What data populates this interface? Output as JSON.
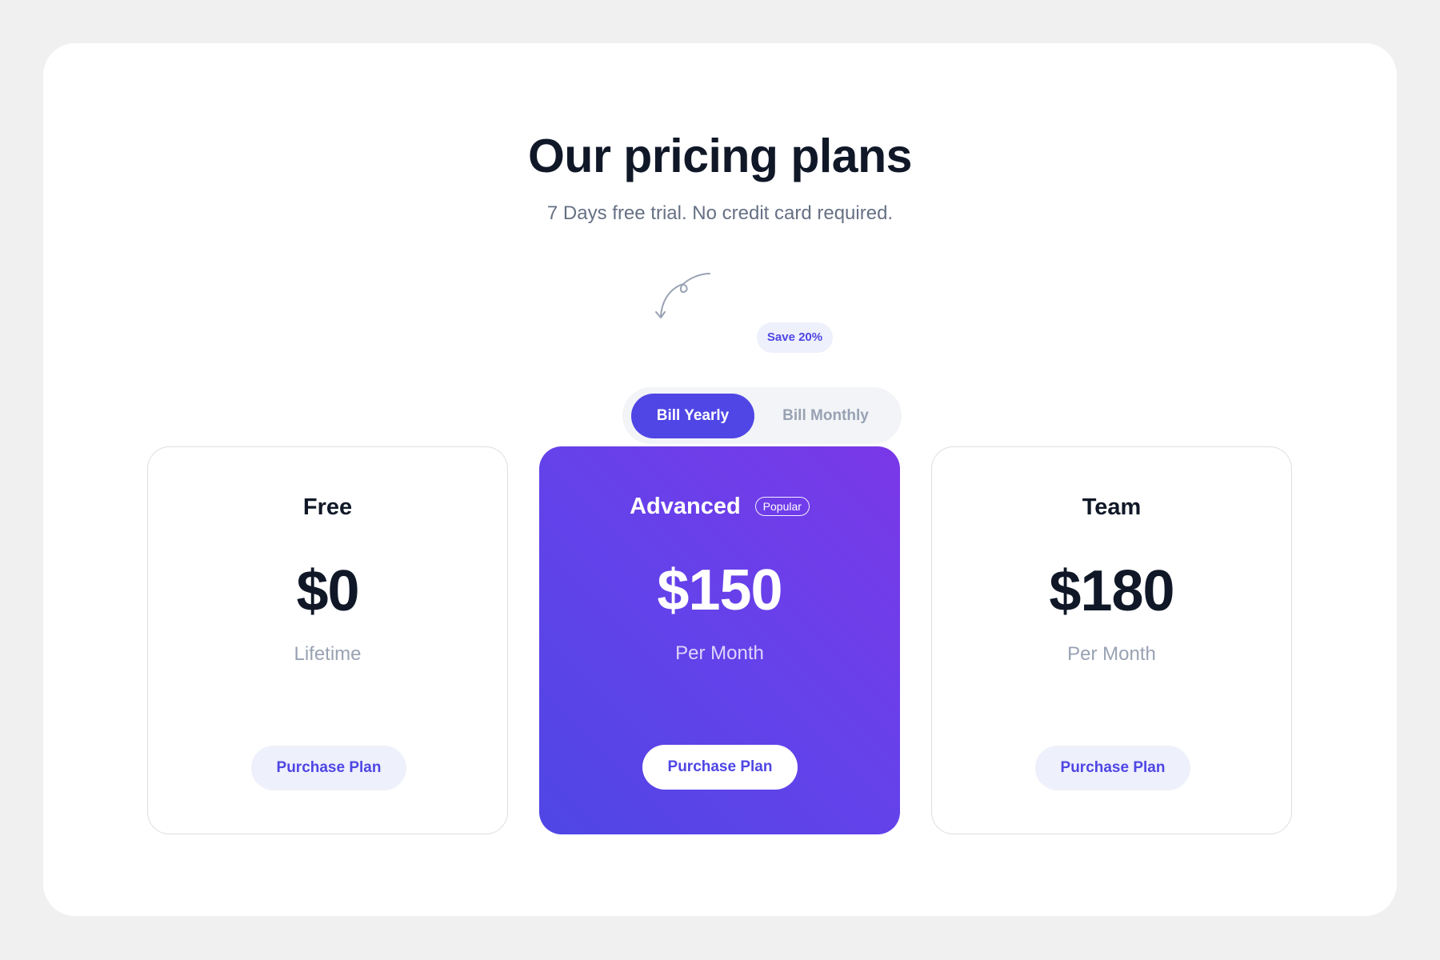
{
  "header": {
    "title": "Our pricing plans",
    "subtitle": "7 Days free trial. No credit card required.",
    "save_badge": "Save 20%"
  },
  "billing_toggle": {
    "yearly_label": "Bill Yearly",
    "monthly_label": "Bill Monthly",
    "selected": "Bill Yearly"
  },
  "plans": [
    {
      "name": "Free",
      "price": "$0",
      "period": "Lifetime",
      "button_label": "Purchase Plan"
    },
    {
      "name": "Advanced",
      "badge": "Popular",
      "price": "$150",
      "period": "Per Month",
      "button_label": "Purchase Plan"
    },
    {
      "name": "Team",
      "price": "$180",
      "period": "Per Month",
      "button_label": "Purchase Plan"
    }
  ],
  "colors": {
    "accent": "#4f46e5",
    "accent_gradient_end": "#7a38e8",
    "heading": "#101828",
    "muted": "#98a2b3",
    "page_background": "#f0f0f0",
    "badge_background": "#eef0fb"
  },
  "icons": {
    "decorative_arrow": "curved-arrow-icon"
  }
}
